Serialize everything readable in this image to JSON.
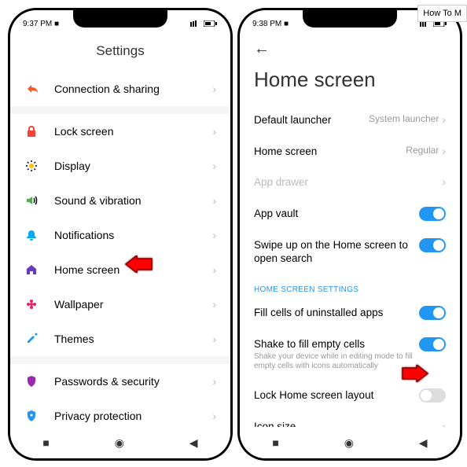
{
  "badge": "How To M",
  "left": {
    "time": "9:37 PM",
    "cam": "■",
    "title": "Settings",
    "group1": [
      {
        "icon": "share",
        "color": "#ff5722",
        "label": "Connection & sharing"
      }
    ],
    "group2": [
      {
        "icon": "lock",
        "color": "#f44336",
        "label": "Lock screen"
      },
      {
        "icon": "sun",
        "color": "#ffc107",
        "label": "Display"
      },
      {
        "icon": "sound",
        "color": "#4caf50",
        "label": "Sound & vibration"
      },
      {
        "icon": "bell",
        "color": "#03a9f4",
        "label": "Notifications"
      },
      {
        "icon": "home",
        "color": "#673ab7",
        "label": "Home screen"
      },
      {
        "icon": "flower",
        "color": "#e91e63",
        "label": "Wallpaper"
      },
      {
        "icon": "brush",
        "color": "#2196f3",
        "label": "Themes"
      }
    ],
    "group3": [
      {
        "icon": "shield",
        "color": "#9c27b0",
        "label": "Passwords & security"
      },
      {
        "icon": "privacy",
        "color": "#2196f3",
        "label": "Privacy protection"
      }
    ]
  },
  "right": {
    "time": "9:38 PM",
    "cam": "■",
    "title": "Home screen",
    "items": [
      {
        "label": "Default launcher",
        "value": "System launcher",
        "type": "link"
      },
      {
        "label": "Home screen",
        "value": "Regular",
        "type": "link"
      },
      {
        "label": "App drawer",
        "type": "link",
        "disabled": true
      },
      {
        "label": "App vault",
        "type": "toggle",
        "on": true
      },
      {
        "label": "Swipe up on the Home screen to open search",
        "type": "toggle",
        "on": true
      }
    ],
    "section": "HOME SCREEN SETTINGS",
    "items2": [
      {
        "label": "Fill cells of uninstalled apps",
        "type": "toggle",
        "on": true
      },
      {
        "label": "Shake to fill empty cells",
        "sub": "Shake your device while in editing mode to fill empty cells with icons automatically",
        "type": "toggle",
        "on": true
      },
      {
        "label": "Lock Home screen layout",
        "type": "toggle",
        "on": false
      },
      {
        "label": "Icon size",
        "type": "link"
      }
    ]
  }
}
